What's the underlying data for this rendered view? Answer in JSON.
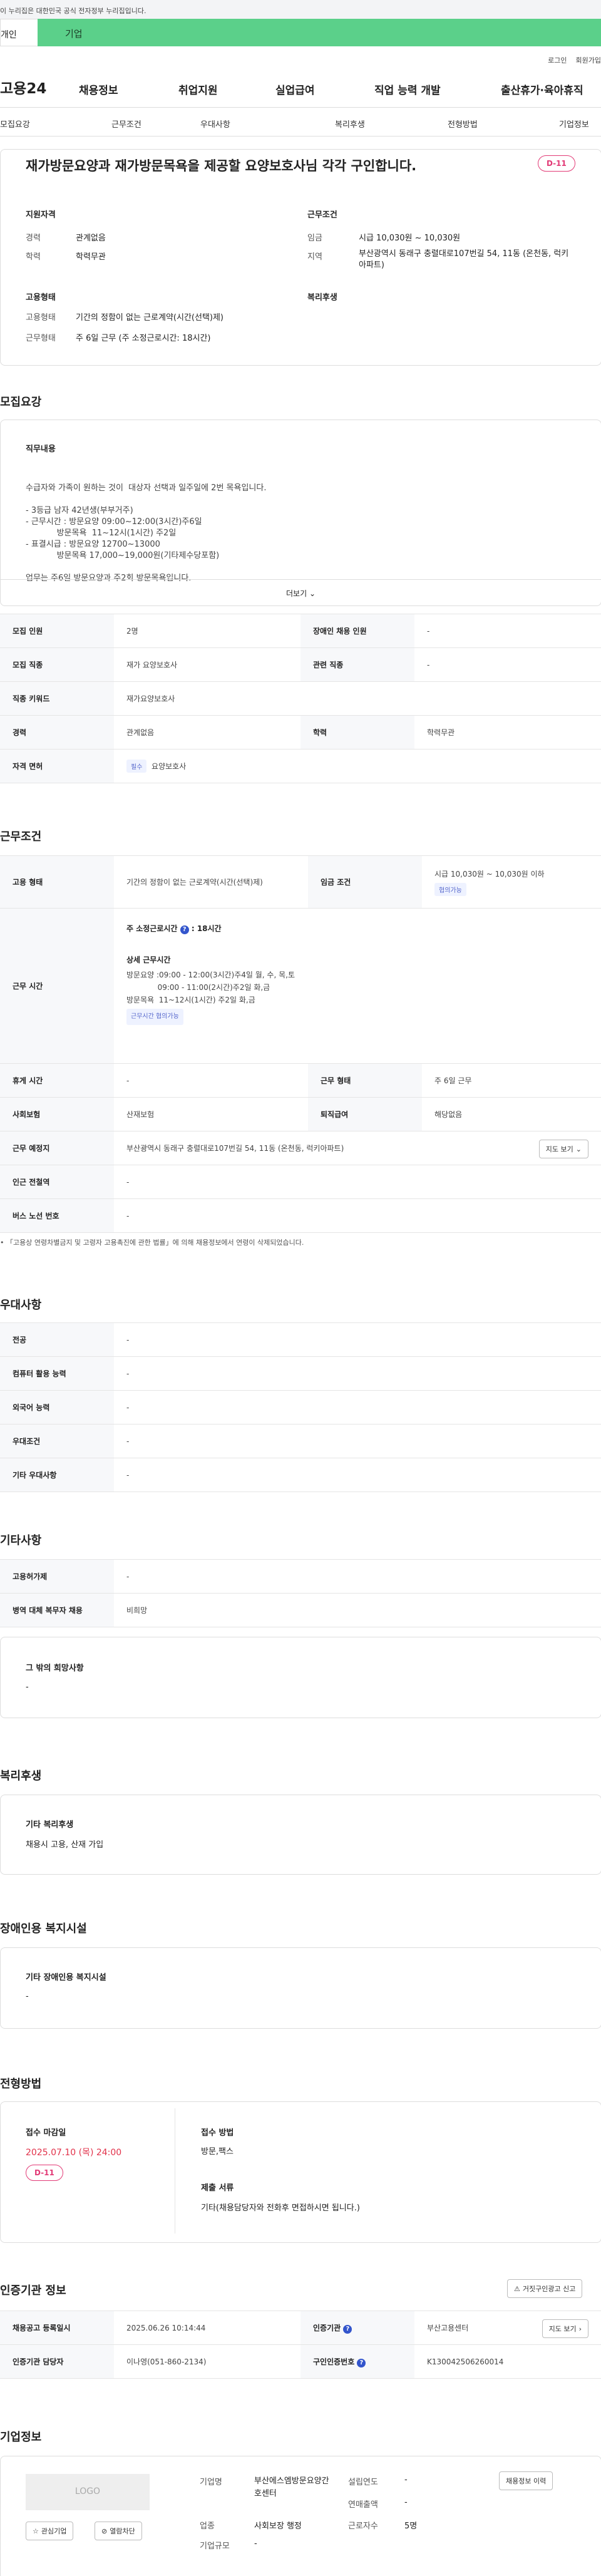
{
  "gov_notice": "이 누리집은 대한민국 공식 전자정부 누리집입니다.",
  "member_tabs": [
    "개인",
    "기업"
  ],
  "util": [
    "로그인",
    "회원가입"
  ],
  "logo": "고용24",
  "gnb": [
    "채용정보",
    "취업지원",
    "실업급여",
    "직업 능력 개발",
    "출산휴가·육아휴직"
  ],
  "anchors": [
    "모집요강",
    "근무조건",
    "우대사항",
    "복리후생",
    "전형방법",
    "기업정보"
  ],
  "job": {
    "title": "재가방문요양과 재가방문목욕을 제공할 요양보호사님 각각 구인합니다.",
    "dday": "D-11"
  },
  "summary": {
    "req_title": "지원자격",
    "cond_title": "근무조건",
    "career_label": "경력",
    "career": "관계없음",
    "edu_label": "학력",
    "edu": "학력무관",
    "wage_label": "임금",
    "wage": "시급 10,030원 ~ 10,030원",
    "loc_label": "지역",
    "loc": "부산광역시 동래구 충렬대로107번길 54, 11동 (온천동, 럭키아파트)",
    "type_title": "고용형태",
    "welfare_title": "복리후생",
    "etype_label": "고용형태",
    "etype": "기간의 정함이 없는 근로계약(시간(선택)제)",
    "wtype_label": "근무형태",
    "wtype": "주 6일 근무 (주 소정근로시간: 18시간)"
  },
  "recruit": {
    "section": "모집요강",
    "duty_title": "직무내용",
    "duty_lines": [
      "수급자와 가족이 원하는 것이  대상자 선택과 일주일에 2번 목욕입니다.",
      "",
      "- 3등급 남자 42년생(부부거주)",
      "- 근무시간 : 방문요양 09:00~12:00(3시간)주6일",
      "            방문목욕  11~12시(1시간) 주2일",
      "- 표결시급 : 방문요양 12700~13000",
      "            방문목욕 17,000~19,000원(기타제수당포함)",
      "",
      "업무는 주6일 방문요양과 주2회 방문목욕입니다."
    ],
    "more": "더보기",
    "rows": [
      {
        "th": "모집 인원",
        "v": "2명",
        "th2": "장애인 채용 인원",
        "v2": "-"
      },
      {
        "th": "모집 직종",
        "v": "재가 요양보호사",
        "th2": "관련 직종",
        "v2": "-"
      },
      {
        "th": "직종 키워드",
        "v": "재가요양보호사"
      },
      {
        "th": "경력",
        "v": "관계없음",
        "th2": "학력",
        "v2": "학력무관"
      },
      {
        "th": "자격 면허",
        "tag": "필수",
        "v": "요양보호사"
      }
    ]
  },
  "work": {
    "section": "근무조건",
    "etype_th": "고용 형태",
    "etype": "기간의 정함이 없는 근로계약(시간(선택)제)",
    "wage_th": "임금 조건",
    "wage": "시급 10,030원 ~ 10,030원 이하",
    "wage_tag": "협의가능",
    "hours_th": "근무 시간",
    "weekly": "주 소정근로시간",
    "weekly_val": ": 18시간",
    "detail_title": "상세 근무시간",
    "detail_lines": [
      "방문요양 :09:00 - 12:00(3시간)주4일 월, 수, 목,토",
      "             09:00 - 11:00(2시간)주2일 화,금",
      "방문목욕  11~12시(1시간) 주2일 화,금"
    ],
    "hours_tag": "근무시간 협의가능",
    "rest_th": "휴게 시간",
    "rest": "-",
    "wform_th": "근무 형태",
    "wform": "주 6일 근무",
    "ins_th": "사회보험",
    "ins": "산재보험",
    "sev_th": "퇴직급여",
    "sev": "해당없음",
    "place_th": "근무 예정지",
    "place": "부산광역시 동래구 충렬대로107번길 54, 11동 (온천동, 럭키아파트)",
    "map_btn": "지도 보기",
    "subway_th": "인근 전철역",
    "subway": "-",
    "bus_th": "버스 노선 번호",
    "bus": "-",
    "note": "• 「고용상 연령차별금지 및 고령자 고용촉진에 관한 법률」에 의해 채용정보에서 연령이 삭제되었습니다."
  },
  "pref": {
    "section": "우대사항",
    "rows": [
      [
        "전공",
        "-"
      ],
      [
        "컴퓨터 활용 능력",
        "-"
      ],
      [
        "외국어 능력",
        "-"
      ],
      [
        "우대조건",
        "-"
      ],
      [
        "기타 우대사항",
        "-"
      ]
    ]
  },
  "etc": {
    "section": "기타사항",
    "rows": [
      [
        "고용허가제",
        "-"
      ],
      [
        "병역 대체 복무자 채용",
        "비희망"
      ]
    ],
    "wish_title": "그 밖의 희망사항",
    "wish": "-"
  },
  "welfare": {
    "section": "복리후생",
    "title": "기타 복리후생",
    "text": "채용시 고용, 산재 가입"
  },
  "disab": {
    "section": "장애인용 복지시설",
    "title": "기타 장애인용 복지시설",
    "text": "-"
  },
  "selection": {
    "section": "전형방법",
    "deadline_title": "접수 마감일",
    "deadline": "2025.07.10 (목) 24:00",
    "dday": "D-11",
    "method_title": "접수 방법",
    "method": "방문,팩스",
    "docs_title": "제출 서류",
    "docs": "기타(채용담당자와 전화후 면접하시면 됩니다.)"
  },
  "cert": {
    "section": "인증기관 정보",
    "report_btn": "거짓구인광고 신고",
    "rows": [
      {
        "th": "채용공고 등록일시",
        "v": "2025.06.26 10:14:44",
        "th2": "인증기관",
        "v2": "부산고용센터",
        "btn": "지도 보기"
      },
      {
        "th": "인증기관 담당자",
        "v": "이나영(051-860-2134)",
        "th2": "구인인증번호",
        "v2": "K130042506260014"
      }
    ]
  },
  "company": {
    "section": "기업정보",
    "logo": "LOGO",
    "fav": "관심기업",
    "block": "열람차단",
    "name_label": "기업명",
    "name": "부산에스엠방문요양간호센터",
    "ind_label": "업종",
    "ind": "사회보장 행정",
    "size_label": "기업규모",
    "size": "-",
    "est_label": "설립연도",
    "est": "-",
    "sales_label": "연매출액",
    "sales": "-",
    "emp_label": "근로자수",
    "emp": "5명",
    "jobs_btn": "채용정보 이력"
  }
}
